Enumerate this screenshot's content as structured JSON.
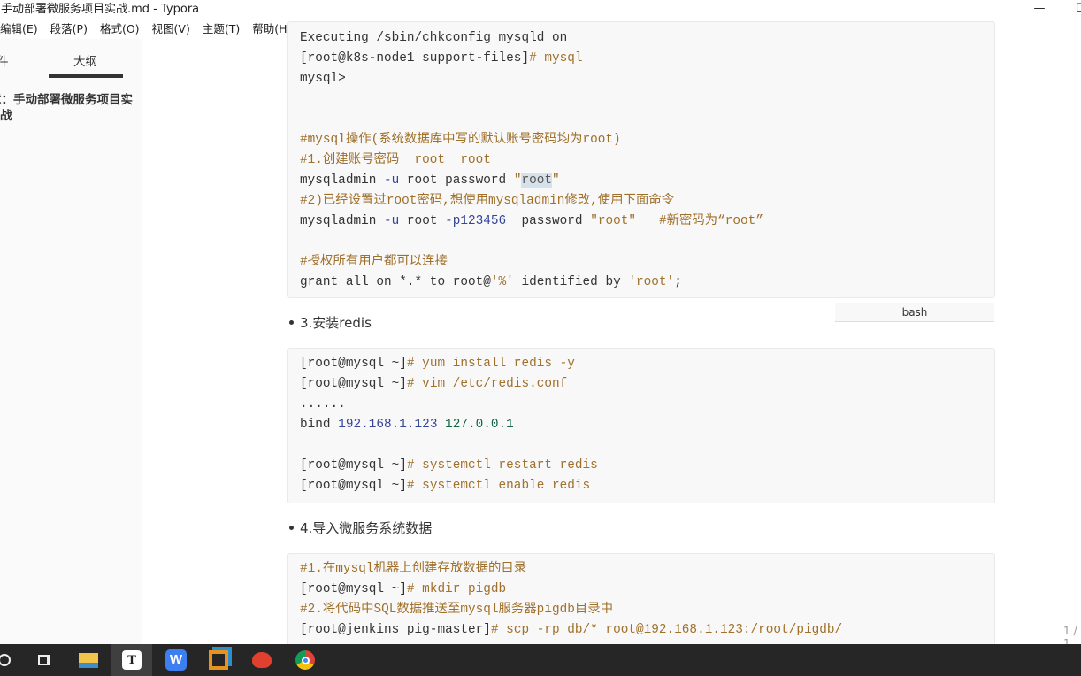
{
  "window": {
    "title": "手动部署微服务项目实战.md - Typora",
    "minimize": "—",
    "maximize": "☐"
  },
  "menu": [
    "编辑(E)",
    "段落(P)",
    "格式(O)",
    "视图(V)",
    "主题(T)",
    "帮助(H)"
  ],
  "sidebar": {
    "tab_files": "件",
    "tab_outline": "大纲",
    "outline_item": "章：手动部署微服务项目实战",
    "footer_back": "‹",
    "footer_source": "</>"
  },
  "blocks": [
    {
      "lines": [
        [
          [
            "Executing /sbin/chkconfig mysqld on",
            ""
          ]
        ],
        [
          [
            "[root@k8s-node1 support-files]",
            ""
          ],
          [
            "# mysql",
            "c-cm"
          ]
        ],
        [
          [
            "mysql>",
            ""
          ]
        ],
        [],
        [],
        [
          [
            "#mysql操作(系统数据库中写的默认账号密码均为root)",
            "c-cm"
          ]
        ],
        [
          [
            "#1.创建账号密码  root  root",
            "c-cm"
          ]
        ],
        [
          [
            "mysqladmin ",
            ""
          ],
          [
            "-u",
            "c-blue"
          ],
          [
            " root password ",
            ""
          ],
          [
            "\"",
            "c-str"
          ],
          [
            "root",
            "sel c-op"
          ],
          [
            "\"",
            "c-str"
          ]
        ],
        [
          [
            "#2)已经设置过root密码,想使用mysqladmin修改,使用下面命令",
            "c-cm"
          ]
        ],
        [
          [
            "mysqladmin ",
            ""
          ],
          [
            "-u",
            "c-blue"
          ],
          [
            " root ",
            ""
          ],
          [
            "-p123456",
            "c-blue"
          ],
          [
            "  password ",
            ""
          ],
          [
            "\"root\"",
            "c-str"
          ],
          [
            "   #新密码为“root”",
            "c-cm"
          ]
        ],
        [],
        [
          [
            "#授权所有用户都可以连接",
            "c-cm"
          ]
        ],
        [
          [
            "grant all on *.* to root@",
            ""
          ],
          [
            "'%'",
            "c-str"
          ],
          [
            " identified by ",
            ""
          ],
          [
            "'root'",
            "c-str"
          ],
          [
            ";",
            ""
          ]
        ]
      ],
      "language": "bash"
    },
    {
      "lines": [
        [
          [
            "[root@mysql ~]",
            ""
          ],
          [
            "# yum install redis -y",
            "c-cm"
          ]
        ],
        [
          [
            "[root@mysql ~]",
            ""
          ],
          [
            "# vim /etc/redis.conf",
            "c-cm"
          ]
        ],
        [
          [
            "......",
            ""
          ]
        ],
        [
          [
            "bind ",
            ""
          ],
          [
            "192.168.1.123",
            "c-blue"
          ],
          [
            " ",
            ""
          ],
          [
            "127.0.0.1",
            "c-num"
          ]
        ],
        [],
        [
          [
            "[root@mysql ~]",
            ""
          ],
          [
            "# systemctl restart redis",
            "c-cm"
          ]
        ],
        [
          [
            "[root@mysql ~]",
            ""
          ],
          [
            "# systemctl enable redis",
            "c-cm"
          ]
        ]
      ]
    },
    {
      "lines": [
        [
          [
            "#1.在mysql机器上创建存放数据的目录",
            "c-cm"
          ]
        ],
        [
          [
            "[root@mysql ~]",
            ""
          ],
          [
            "# mkdir pigdb",
            "c-cm"
          ]
        ],
        [
          [
            "#2.将代码中SQL数据推送至mysql服务器pigdb目录中",
            "c-cm"
          ]
        ],
        [
          [
            "[root@jenkins pig-master]",
            ""
          ],
          [
            "# scp -rp db/* root@192.168.1.123:/root/pigdb/",
            "c-cm"
          ]
        ]
      ]
    }
  ],
  "bullets": [
    "3.安装redis",
    "4.导入微服务系统数据"
  ],
  "status": {
    "page_count": "1 / 1"
  },
  "taskbar": [
    "cortana-icon",
    "task-view-icon",
    "file-explorer-icon",
    "typora-icon",
    "wps-icon",
    "vmware-icon",
    "app-icon",
    "chrome-icon"
  ]
}
